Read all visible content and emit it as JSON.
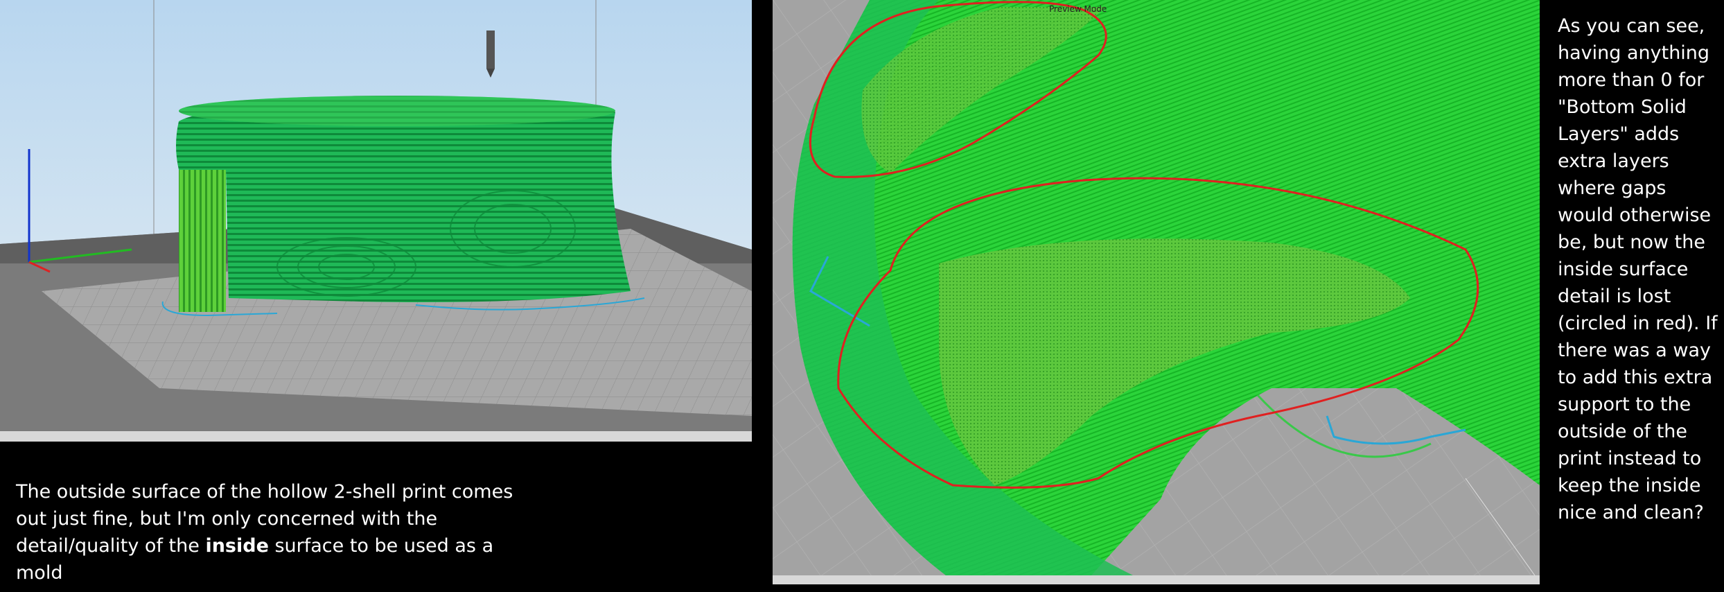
{
  "left_panel": {
    "caption_part1": "The outside surface of the hollow 2-shell print comes out just fine, but I'm only concerned with the detail/quality of the ",
    "caption_bold": "inside",
    "caption_part2": " surface to be used as a mold"
  },
  "right_panel": {
    "mode_label": "Preview Mode",
    "caption": "As you can see, having anything more than 0 for \"Bottom Solid Layers\" adds extra layers where gaps would otherwise be, but now the inside surface detail is lost (circled in red). If there was a way to add this extra support to the outside of the print instead to keep the inside nice and clean?"
  },
  "colors": {
    "print_green": "#22c25a",
    "infill_green": "#4ed44a",
    "outline_cyan": "#2aa7d6",
    "annotation_red": "#e02020",
    "sky_blue": "#c7dbe9",
    "bed_gray": "#9c9c9c"
  },
  "icons": [
    "nozzle-icon",
    "axis-gizmo-icon"
  ]
}
